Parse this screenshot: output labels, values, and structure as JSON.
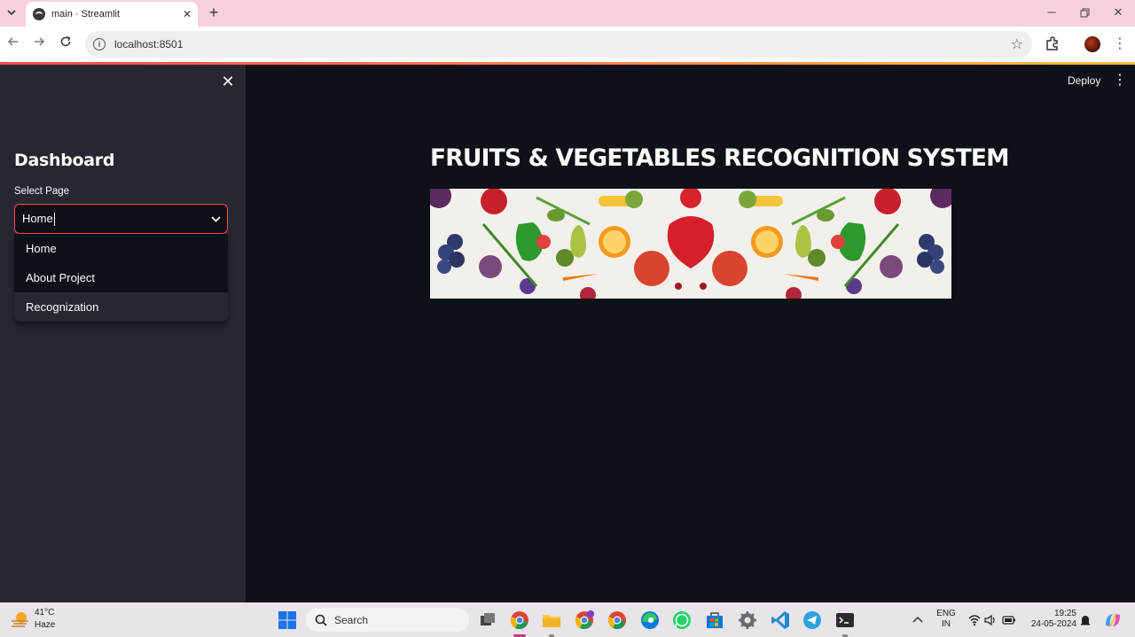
{
  "browser": {
    "tab_title": "main · Streamlit",
    "url": "localhost:8501"
  },
  "sidebar": {
    "heading": "Dashboard",
    "select_label": "Select Page",
    "select_value": "Home",
    "options": [
      "Home",
      "About Project",
      "Recognization"
    ]
  },
  "header": {
    "deploy_label": "Deploy"
  },
  "main": {
    "title": "FRUITS & VEGETABLES RECOGNITION SYSTEM"
  },
  "taskbar": {
    "temperature": "41°C",
    "weather": "Haze",
    "search_placeholder": "Search",
    "lang_1": "ENG",
    "lang_2": "IN",
    "time": "19:25",
    "date": "24-05-2024"
  },
  "colors": {
    "accent": "#ff4b4b",
    "sidebar_bg": "#262730",
    "main_bg": "#0e1117"
  }
}
